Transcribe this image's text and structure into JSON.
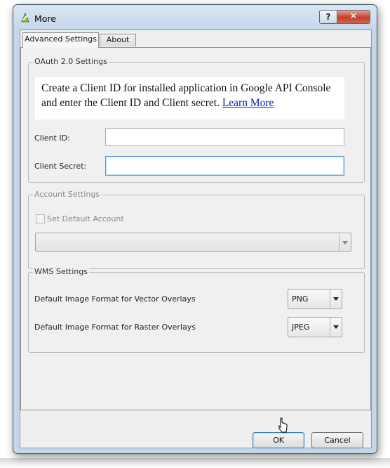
{
  "window": {
    "title": "More"
  },
  "titlebar": {
    "help_glyph": "?",
    "close_glyph": "✕"
  },
  "tabs": [
    {
      "label": "Advanced Settings",
      "active": true
    },
    {
      "label": "About",
      "active": false
    }
  ],
  "oauth": {
    "legend": "OAuth 2.0 Settings",
    "info_text": "Create a Client ID for installed application in Google API Console and enter the Client ID and Client secret.",
    "learn_more": "Learn More",
    "client_id_label": "Client ID:",
    "client_id_value": "",
    "client_secret_label": "Client Secret:",
    "client_secret_value": ""
  },
  "account": {
    "legend": "Account Settings",
    "checkbox_label": "Set Default Account",
    "combo_value": ""
  },
  "wms": {
    "legend": "WMS Settings",
    "vector_label": "Default Image Format for Vector Overlays",
    "vector_value": "PNG",
    "raster_label": "Default Image Format for Raster Overlays",
    "raster_value": "JPEG"
  },
  "buttons": {
    "ok": "OK",
    "cancel": "Cancel"
  },
  "icons": {
    "app": "qgis-app-icon",
    "help": "help-icon",
    "close": "close-icon",
    "dropdown": "chevron-down-icon",
    "cursor": "mouse-cursor-icon"
  }
}
